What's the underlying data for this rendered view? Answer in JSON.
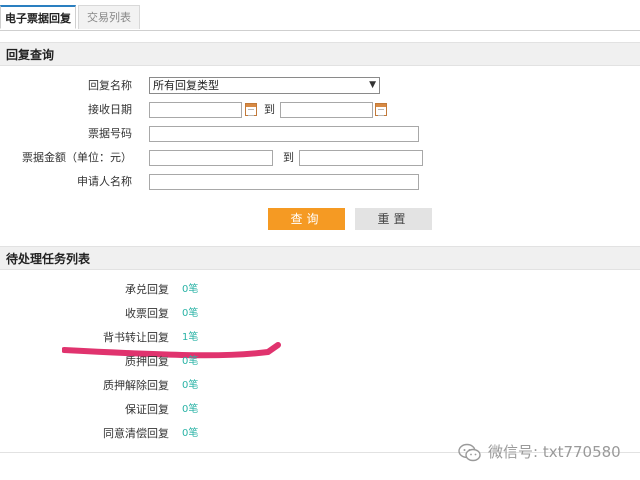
{
  "tabs": [
    {
      "label": "电子票据回复",
      "active": true
    },
    {
      "label": "交易列表",
      "active": false
    }
  ],
  "query_section": {
    "title": "回复查询",
    "fields": {
      "reply_name_label": "回复名称",
      "reply_name_value": "所有回复类型",
      "receive_date_label": "接收日期",
      "to_label": "到",
      "bill_no_label": "票据号码",
      "amount_label": "票据金额（单位：元）",
      "applicant_label": "申请人名称"
    },
    "buttons": {
      "query": "查询",
      "reset": "重置"
    }
  },
  "task_section": {
    "title": "待处理任务列表",
    "items": [
      {
        "label": "承兑回复",
        "count": "0笔"
      },
      {
        "label": "收票回复",
        "count": "0笔"
      },
      {
        "label": "背书转让回复",
        "count": "1笔"
      },
      {
        "label": "质押回复",
        "count": "0笔"
      },
      {
        "label": "质押解除回复",
        "count": "0笔"
      },
      {
        "label": "保证回复",
        "count": "0笔"
      },
      {
        "label": "同意清偿回复",
        "count": "0笔"
      }
    ]
  },
  "watermark": {
    "text": "微信号: txt770580"
  },
  "colors": {
    "accent_tab": "#2a7fc0",
    "primary_button": "#f59a23",
    "count_text": "#2ab3a6",
    "highlight_mark": "#e0336e"
  }
}
